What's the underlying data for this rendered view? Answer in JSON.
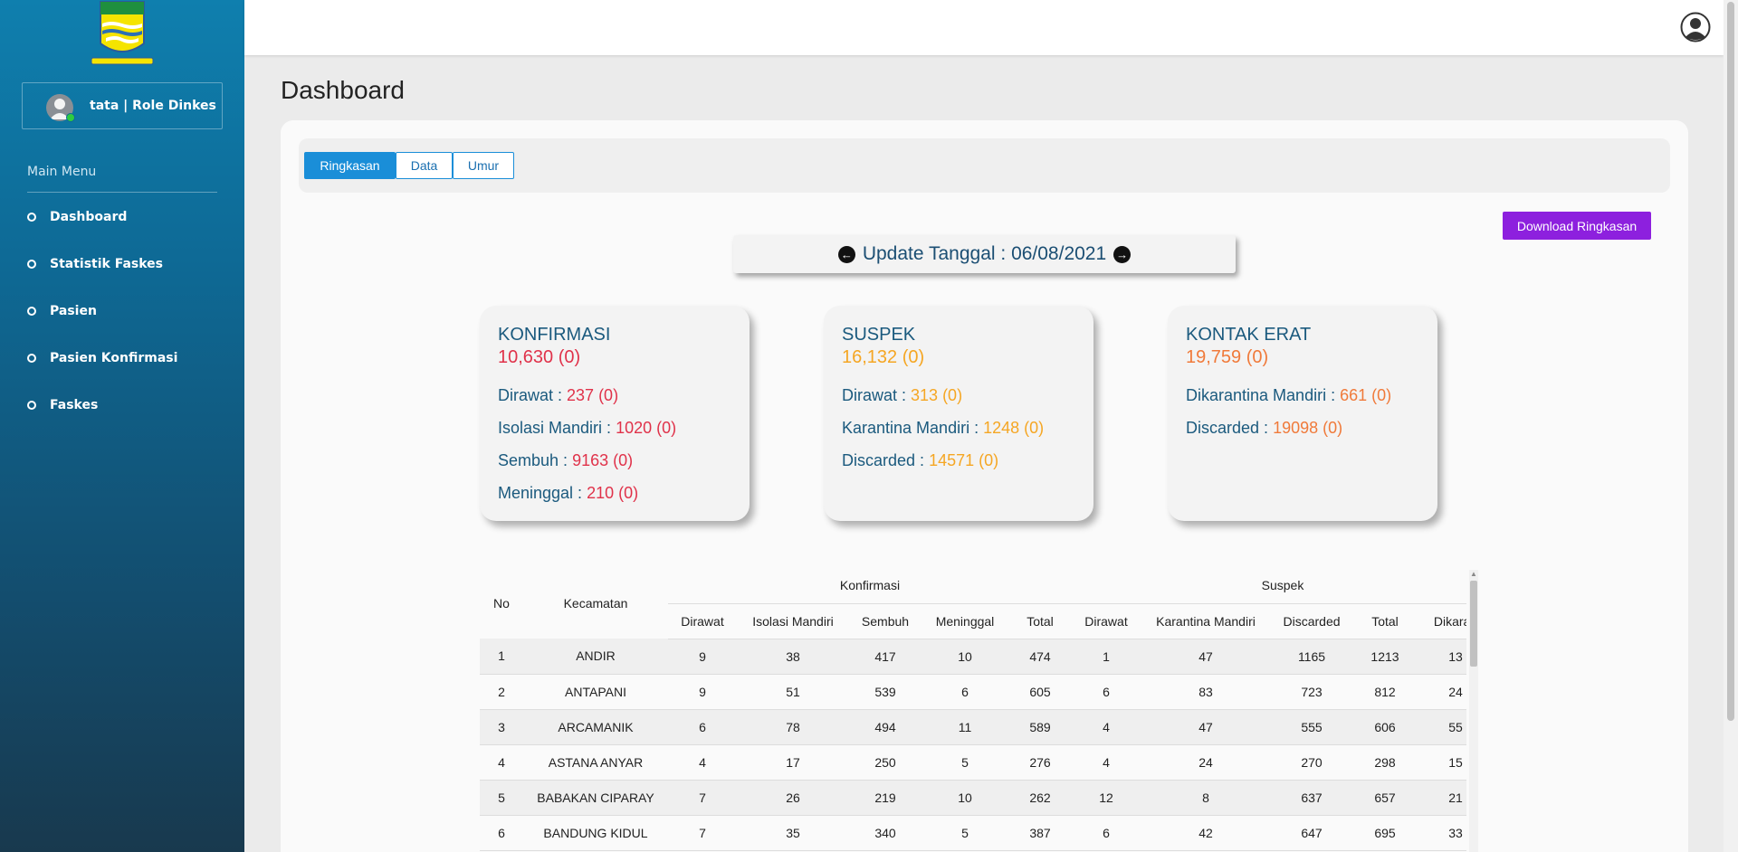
{
  "user": {
    "name": "tata | Role Dinkes"
  },
  "menu": {
    "title": "Main Menu",
    "items": [
      {
        "label": "Dashboard"
      },
      {
        "label": "Statistik Faskes"
      },
      {
        "label": "Pasien"
      },
      {
        "label": "Pasien Konfirmasi"
      },
      {
        "label": "Faskes"
      }
    ]
  },
  "page": {
    "title": "Dashboard"
  },
  "tabs": [
    {
      "label": "Ringkasan",
      "active": true
    },
    {
      "label": "Data",
      "active": false
    },
    {
      "label": "Umur",
      "active": false
    }
  ],
  "download_label": "Download Ringkasan",
  "update": {
    "text": "Update Tanggal : 06/08/2021"
  },
  "stats": {
    "konfirmasi": {
      "title": "KONFIRMASI",
      "total": "10,630 (0)",
      "lines": [
        {
          "label": "Dirawat :",
          "value": "237 (0)"
        },
        {
          "label": "Isolasi Mandiri :",
          "value": "1020 (0)"
        },
        {
          "label": "Sembuh :",
          "value": "9163 (0)"
        },
        {
          "label": "Meninggal :",
          "value": "210 (0)"
        }
      ]
    },
    "suspek": {
      "title": "SUSPEK",
      "total": "16,132 (0)",
      "lines": [
        {
          "label": "Dirawat :",
          "value": "313 (0)"
        },
        {
          "label": "Karantina Mandiri :",
          "value": "1248 (0)"
        },
        {
          "label": "Discarded :",
          "value": "14571 (0)"
        }
      ]
    },
    "kontak": {
      "title": "KONTAK ERAT",
      "total": "19,759 (0)",
      "lines": [
        {
          "label": "Dikarantina Mandiri :",
          "value": "661 (0)"
        },
        {
          "label": "Discarded :",
          "value": "19098 (0)"
        }
      ]
    }
  },
  "table": {
    "headers": {
      "no": "No",
      "kecamatan": "Kecamatan",
      "konfirmasi": "Konfirmasi",
      "suspek": "Suspek",
      "k_cols": [
        "Dirawat",
        "Isolasi Mandiri",
        "Sembuh",
        "Meninggal",
        "Total"
      ],
      "s_cols": [
        "Dirawat",
        "Karantina Mandiri",
        "Discarded",
        "Total",
        "Dikaran"
      ]
    },
    "rows": [
      [
        "1",
        "ANDIR",
        "9",
        "38",
        "417",
        "10",
        "474",
        "1",
        "47",
        "1165",
        "1213",
        "13"
      ],
      [
        "2",
        "ANTAPANI",
        "9",
        "51",
        "539",
        "6",
        "605",
        "6",
        "83",
        "723",
        "812",
        "24"
      ],
      [
        "3",
        "ARCAMANIK",
        "6",
        "78",
        "494",
        "11",
        "589",
        "4",
        "47",
        "555",
        "606",
        "55"
      ],
      [
        "4",
        "ASTANA ANYAR",
        "4",
        "17",
        "250",
        "5",
        "276",
        "4",
        "24",
        "270",
        "298",
        "15"
      ],
      [
        "5",
        "BABAKAN CIPARAY",
        "7",
        "26",
        "219",
        "10",
        "262",
        "12",
        "8",
        "637",
        "657",
        "21"
      ],
      [
        "6",
        "BANDUNG KIDUL",
        "7",
        "35",
        "340",
        "5",
        "387",
        "6",
        "42",
        "647",
        "695",
        "33"
      ]
    ]
  }
}
